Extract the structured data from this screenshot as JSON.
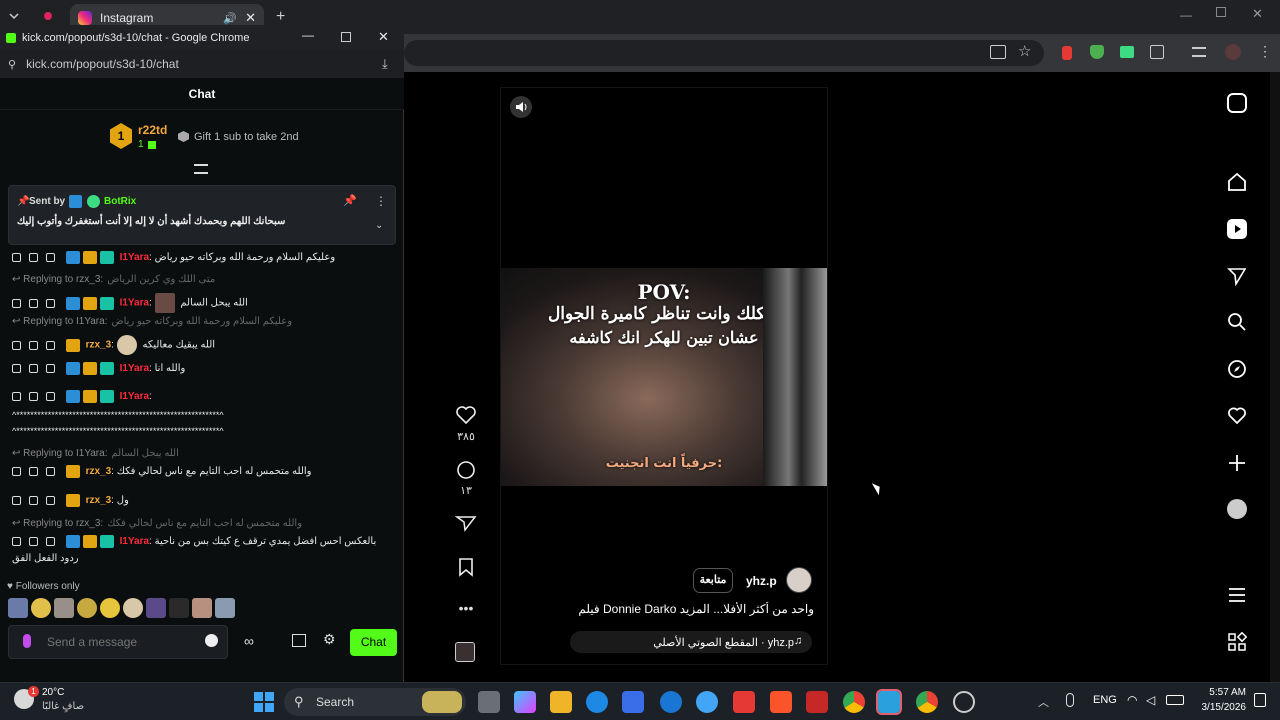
{
  "browser": {
    "tab_title": "Instagram",
    "popup_window_title": "kick.com/popout/s3d-10/chat - Google Chrome",
    "popup_url": "kick.com/popout/s3d-10/chat"
  },
  "chat": {
    "header": "Chat",
    "gifter_rank": "1",
    "gifter_name": "r22td",
    "gifter_count": "1",
    "gift_prompt": "Gift 1 sub to take 2nd",
    "pinned": {
      "sent_by_label": "Sent by",
      "sender": "BotRix",
      "text": "سبحانك اللهم وبحمدك أشهد أن لا إله إلا أنت أستغفرك وأتوب إليك"
    },
    "messages": [
      {
        "user": "I1Yara",
        "text": "وعليكم السلام ورحمة الله وبركاته حيو رياض"
      },
      {
        "reply_to": "Replying to rzx_3:",
        "reply_text": "متى اللك وي كرين الرياض",
        "user": "I1Yara",
        "text": "الله يبحل السالم"
      },
      {
        "reply_to": "Replying to I1Yara:",
        "reply_text": "وعليكم السلام ورحمة الله وبركاته حيو رياض",
        "user": "rzx_3",
        "text": "الله يبقيك معاليكه"
      },
      {
        "user": "I1Yara",
        "text": "والله انا"
      },
      {
        "user": "I1Yara",
        "text": ""
      },
      {
        "raw": "^**********************************************************^"
      },
      {
        "raw": "^**********************************************************^"
      },
      {
        "reply_to": "Replying to I1Yara:",
        "reply_text": "الله يبحل السالم",
        "user": "rzx_3",
        "text": "والله متحمس له احب التايم مع ناس لحالي فكك"
      },
      {
        "user": "rzx_3",
        "text": "ول"
      },
      {
        "reply_to": "Replying to rzx_3:",
        "reply_text": "والله متحمس له احب التايم مع ناس لحالي فكك",
        "user": "I1Yara",
        "text": "بالعكس احس افضل يمدي ترقف ع كيتك بس من ناحية"
      },
      {
        "raw": "ردود الفعل الفق"
      }
    ],
    "followers_only": "Followers only",
    "send_placeholder": "Send a message",
    "chat_button": "Chat"
  },
  "reel": {
    "overlay_pov": "POV:",
    "overlay_line1": "شكلك وانت تناظر كاميرة الجوال",
    "overlay_line2": "عشان تبين للهكر انك كاشفه",
    "subtitle": "حرفياً انت انجنيت:",
    "likes": "٣٨٥",
    "comments": "١٣",
    "author": "yhz.p",
    "follow_button": "متابعة",
    "caption": "فيلم Donnie Darko واحد من أكثر الأفلا... المزيد",
    "audio": "المقطع الصوتي الأصلي · yhz.p"
  },
  "taskbar": {
    "weather_temp": "20°C",
    "weather_desc": "صافٍ غالبًا",
    "weather_badge": "1",
    "search_label": "Search",
    "language": "ENG",
    "time": "5:57 AM",
    "date": "3/15/2026"
  },
  "colors": {
    "kick_green": "#53fc18",
    "username_red": "#ff2a3b",
    "username_orange": "#f2a93b"
  }
}
